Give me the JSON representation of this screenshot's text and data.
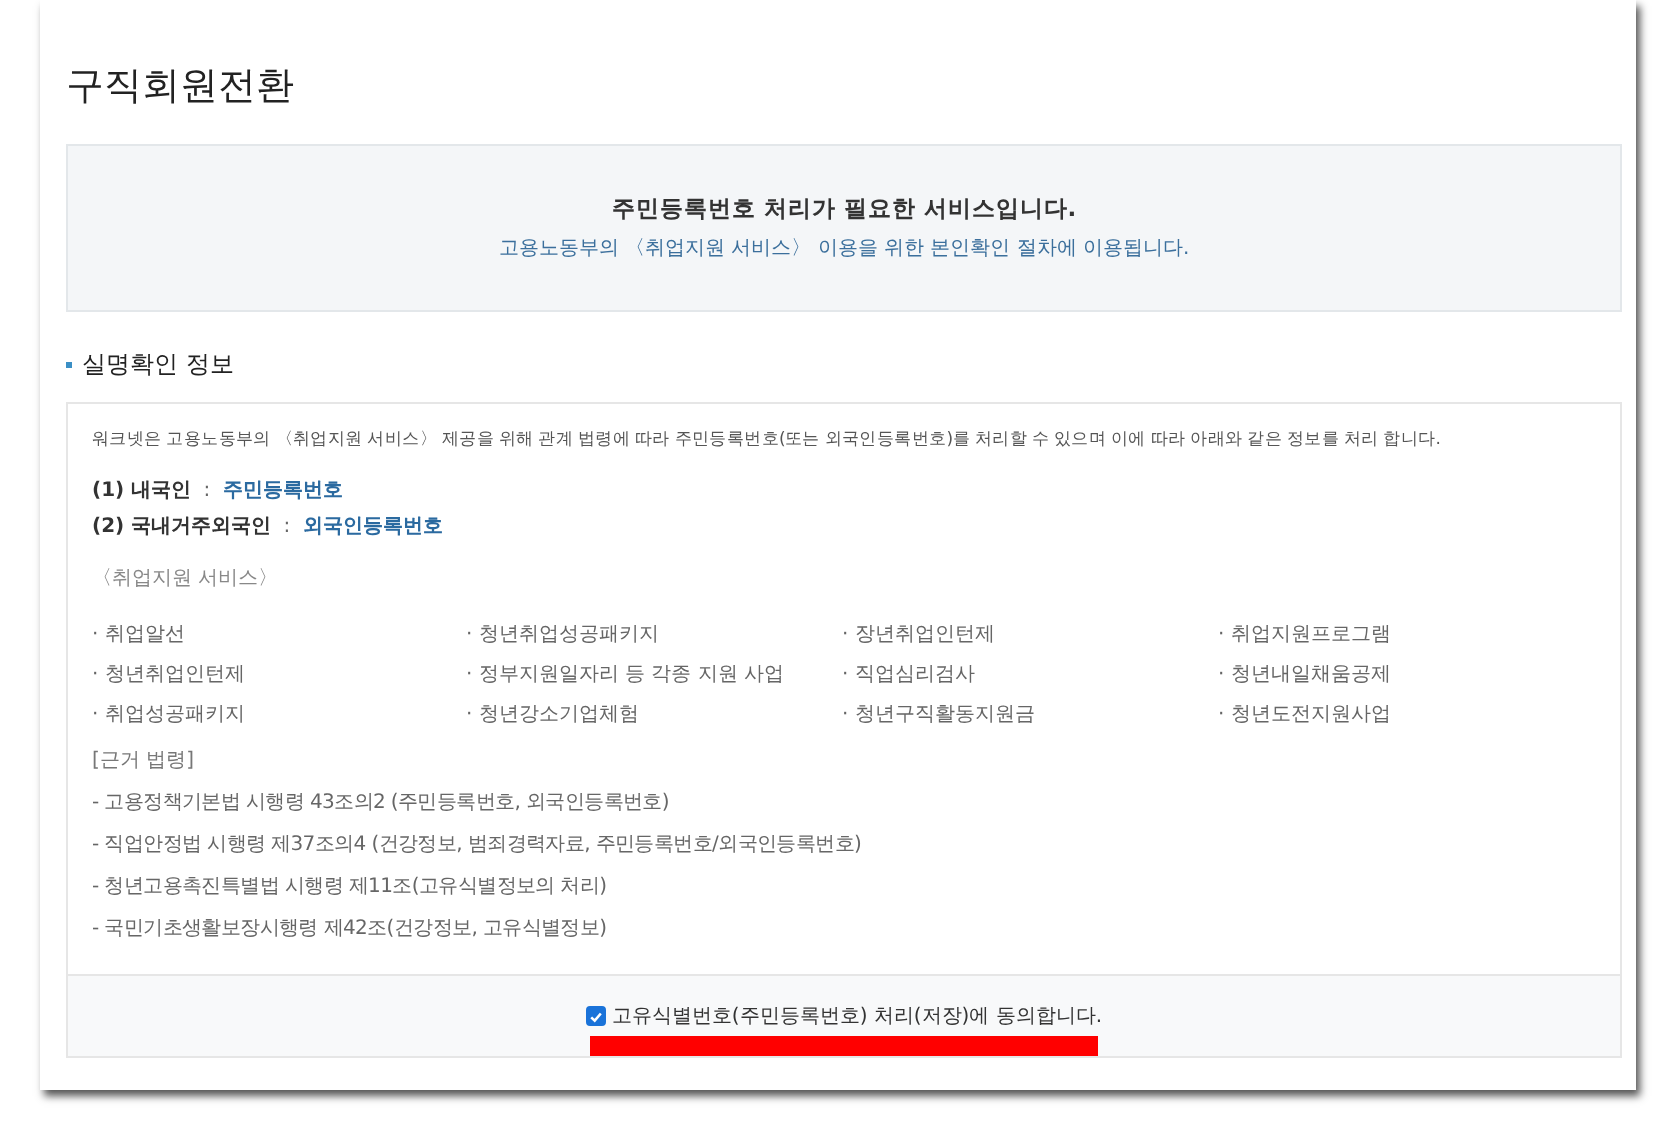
{
  "page_title": "구직회원전환",
  "notice": {
    "headline": "주민등록번호 처리가 필요한 서비스입니다.",
    "subtext": "고용노동부의 〈취업지원 서비스〉 이용을 위한 본인확인 절차에 이용됩니다."
  },
  "section_title": "실명확인 정보",
  "intro": "워크넷은 고용노동부의 〈취업지원 서비스〉 제공을 위해 관계 법령에 따라 주민등록번호(또는 외국인등록번호)를 처리할 수 있으며 이에 따라 아래와 같은 정보를 처리 합니다.",
  "id_types": [
    {
      "label": "(1) 내국인",
      "separator": ":",
      "value": "주민등록번호"
    },
    {
      "label": "(2) 국내거주외국인",
      "separator": ":",
      "value": "외국인등록번호"
    }
  ],
  "services_heading": "〈취업지원 서비스〉",
  "services": [
    "· 취업알선",
    "· 청년취업성공패키지",
    "· 장년취업인턴제",
    "· 취업지원프로그램",
    "· 청년취업인턴제",
    "· 정부지원일자리 등 각종 지원 사업",
    "· 직업심리검사",
    "· 청년내일채움공제",
    "· 취업성공패키지",
    "· 청년강소기업체험",
    "· 청년구직활동지원금",
    "· 청년도전지원사업"
  ],
  "laws_heading": "[근거 법령]",
  "laws": [
    "- 고용정책기본법 시행령 43조의2 (주민등록번호, 외국인등록번호)",
    "- 직업안정법 시행령 제37조의4 (건강정보, 범죄경력자료, 주민등록번호/외국인등록번호)",
    "- 청년고용촉진특별법 시행령 제11조(고유식별정보의 처리)",
    "- 국민기초생활보장시행령 제42조(건강정보, 고유식별정보)"
  ],
  "consent": {
    "label": "고유식별번호(주민등록번호) 처리(저장)에 동의합니다.",
    "checked": true
  }
}
